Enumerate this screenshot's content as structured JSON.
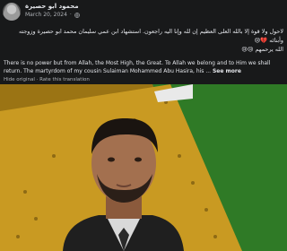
{
  "post": {
    "author": "محمود ابو حصيرة",
    "date": "March 20, 2024",
    "privacy_icon": "globe-icon",
    "arabic_lines": [
      "لاحول ولا قوة إلا بالله العلى العظيم إن لله وإنا اليه راجعون. استشهاد ابن عمي سليمان محمد ابو حصيرة وزوجته",
      "وأبنائه 💔😢",
      "الله يرحمهم 😢😢"
    ],
    "translation_text": "There is no power but from Allah, the Most High, the Great. To Allah we belong and to Him we shall return. The martyrdom of my cousin Sulaiman Mohammed Abu Hasira, his ...",
    "see_more": "See more",
    "hide_original": "Hide original",
    "rate_translation": "Rate this translation",
    "link_separator": "·"
  },
  "colors": {
    "background": "#18191a",
    "text": "#e4e6eb",
    "secondary": "#b0b3b8",
    "photo_yellow": "#d4a62a",
    "photo_green": "#3b8a2e"
  }
}
